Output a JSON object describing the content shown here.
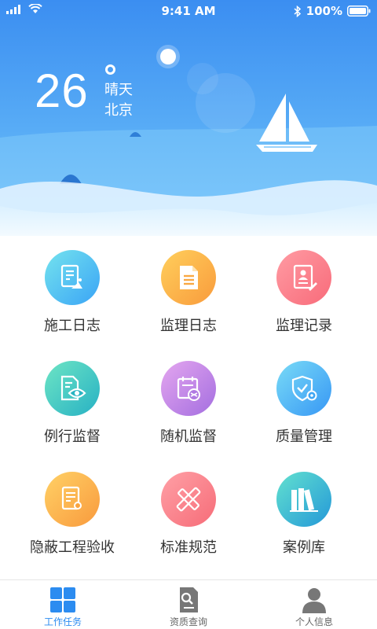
{
  "status_bar": {
    "time": "9:41 AM",
    "battery": "100%"
  },
  "weather": {
    "temperature": "26",
    "condition": "晴天",
    "city": "北京"
  },
  "grid": {
    "items": [
      {
        "label": "施工日志"
      },
      {
        "label": "监理日志"
      },
      {
        "label": "监理记录"
      },
      {
        "label": "例行监督"
      },
      {
        "label": "随机监督"
      },
      {
        "label": "质量管理"
      },
      {
        "label": "隐蔽工程验收"
      },
      {
        "label": "标准规范"
      },
      {
        "label": "案例库"
      }
    ]
  },
  "tabbar": {
    "items": [
      {
        "label": "工作任务",
        "active": true
      },
      {
        "label": "资质查询",
        "active": false
      },
      {
        "label": "个人信息",
        "active": false
      }
    ]
  },
  "colors": {
    "accent": "#2c8cf0",
    "sky_top": "#3d8ff0",
    "sky_bottom": "#7ec9fb"
  }
}
